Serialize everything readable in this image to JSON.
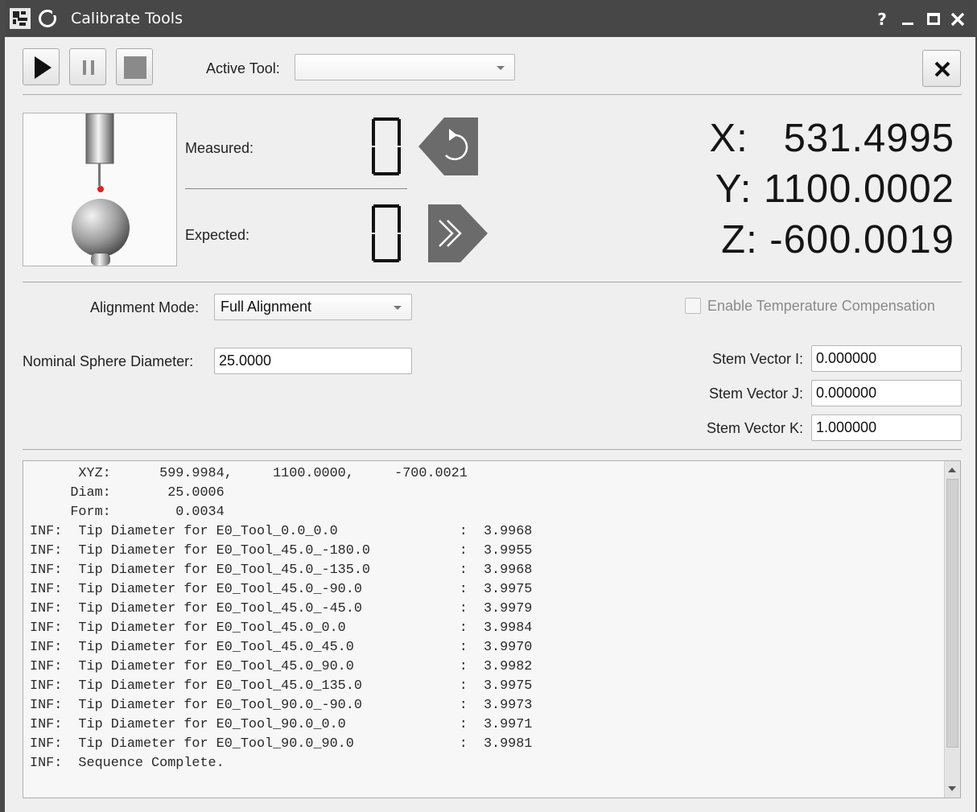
{
  "window": {
    "title": "Calibrate Tools",
    "help_label": "?"
  },
  "toolbar": {
    "active_tool_label": "Active Tool:",
    "active_tool_value": ""
  },
  "display": {
    "measured_label": "Measured:",
    "expected_label": "Expected:",
    "measured_value": 0,
    "expected_value": 0,
    "x_line": "X:   531.4995",
    "y_line": "Y: 1100.0002",
    "z_line": "Z: -600.0019"
  },
  "settings": {
    "alignment_mode_label": "Alignment Mode:",
    "alignment_mode_value": "Full Alignment",
    "temp_comp_label": "Enable Temperature Compensation",
    "temp_comp_checked": false,
    "nominal_diameter_label": "Nominal Sphere Diameter:",
    "nominal_diameter_value": "25.0000",
    "stem_i_label": "Stem Vector I:",
    "stem_i_value": "0.000000",
    "stem_j_label": "Stem Vector J:",
    "stem_j_value": "0.000000",
    "stem_k_label": "Stem Vector K:",
    "stem_k_value": "1.000000"
  },
  "log": {
    "lines": [
      "      XYZ:      599.9984,     1100.0000,     -700.0021",
      "     Diam:       25.0006",
      "     Form:        0.0034",
      "INF:  Tip Diameter for E0_Tool_0.0_0.0               :  3.9968",
      "INF:  Tip Diameter for E0_Tool_45.0_-180.0           :  3.9955",
      "INF:  Tip Diameter for E0_Tool_45.0_-135.0           :  3.9968",
      "INF:  Tip Diameter for E0_Tool_45.0_-90.0            :  3.9975",
      "INF:  Tip Diameter for E0_Tool_45.0_-45.0            :  3.9979",
      "INF:  Tip Diameter for E0_Tool_45.0_0.0              :  3.9984",
      "INF:  Tip Diameter for E0_Tool_45.0_45.0             :  3.9970",
      "INF:  Tip Diameter for E0_Tool_45.0_90.0             :  3.9982",
      "INF:  Tip Diameter for E0_Tool_45.0_135.0            :  3.9975",
      "INF:  Tip Diameter for E0_Tool_90.0_-90.0            :  3.9973",
      "INF:  Tip Diameter for E0_Tool_90.0_0.0              :  3.9971",
      "INF:  Tip Diameter for E0_Tool_90.0_90.0             :  3.9981",
      "INF:  Sequence Complete."
    ]
  },
  "colors": {
    "titlebar": "#474747",
    "window_bg": "#efefef",
    "sphere_dot": "#e02020",
    "nav_button": "#6b6b6b"
  }
}
